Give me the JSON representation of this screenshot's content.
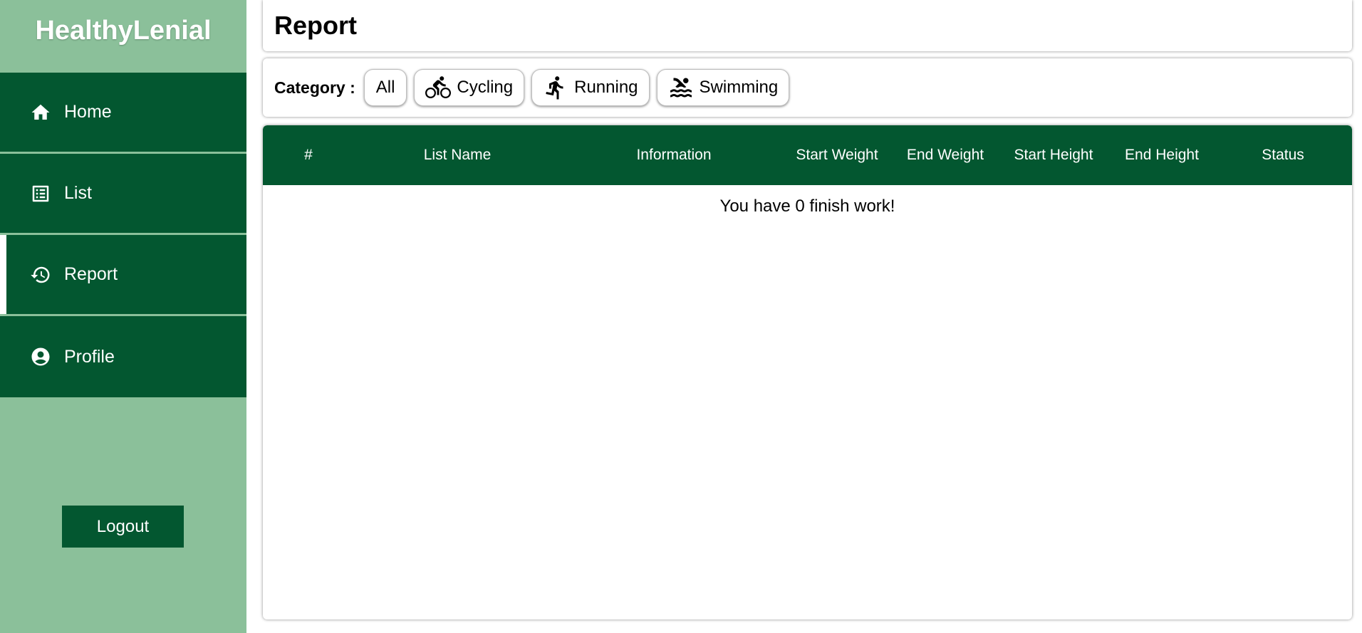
{
  "brand": {
    "name": "HealthyLenial"
  },
  "sidebar": {
    "items": [
      {
        "label": "Home",
        "icon": "home-icon"
      },
      {
        "label": "List",
        "icon": "list-icon"
      },
      {
        "label": "Report",
        "icon": "history-icon",
        "active": true
      },
      {
        "label": "Profile",
        "icon": "account-circle-icon"
      }
    ],
    "logout_label": "Logout"
  },
  "header": {
    "title": "Report"
  },
  "category": {
    "label": "Category :",
    "options": [
      {
        "label": "All",
        "icon": ""
      },
      {
        "label": "Cycling",
        "icon": "bike-icon"
      },
      {
        "label": "Running",
        "icon": "run-icon"
      },
      {
        "label": "Swimming",
        "icon": "swim-icon"
      }
    ]
  },
  "table": {
    "columns": [
      "#",
      "List Name",
      "Information",
      "Start Weight",
      "End Weight",
      "Start Height",
      "End Height",
      "Status"
    ],
    "empty_message": "You have 0 finish work!"
  },
  "colors": {
    "sidebar_bg": "#8bc09a",
    "primary_dark": "#035730",
    "white": "#ffffff"
  }
}
